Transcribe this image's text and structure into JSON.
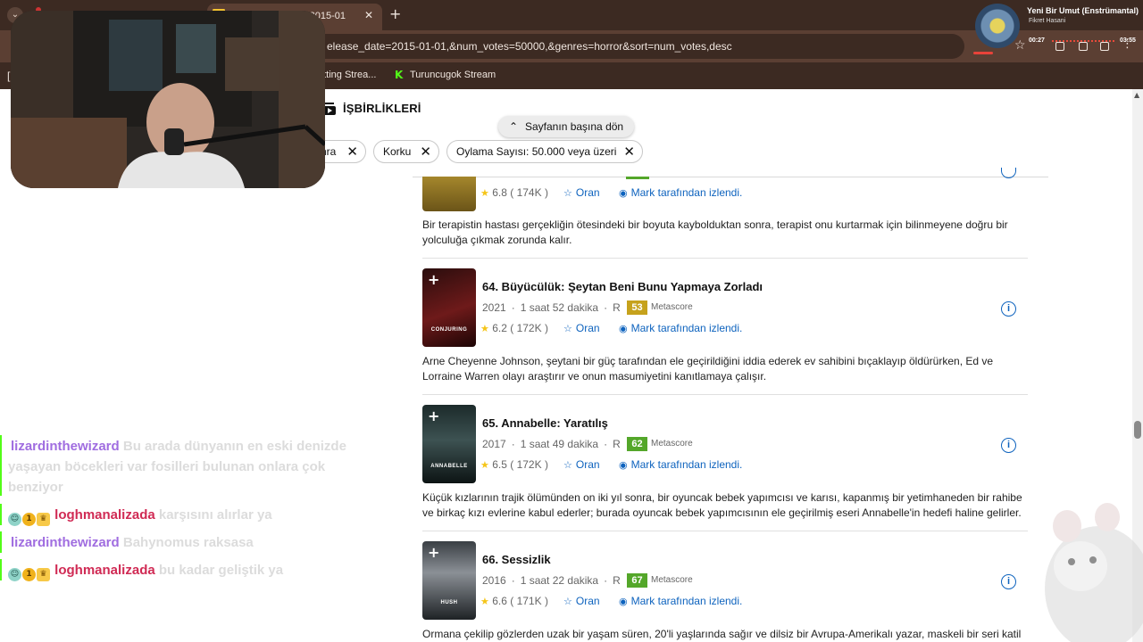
{
  "browser": {
    "tab_title": "az 2015-01",
    "url": "elease_date=2015-01-01,&num_votes=50000,&genres=horror&sort=num_votes,desc",
    "bookmarks": [
      "atting Strea...",
      "Turuncugok Stream"
    ]
  },
  "page": {
    "collab_label": "İŞBİRLİKLERİ",
    "back_to_top": "Sayfanın başına dön",
    "filter_chips": [
      {
        "label": "hra"
      },
      {
        "label": "Korku"
      },
      {
        "label": "Oylama Sayısı: 50.000 veya üzeri"
      }
    ],
    "partial_item": {
      "rating": "6.8",
      "votes": "( 174K )",
      "rate_label": "Oran",
      "seen_label": "Mark tarafından izlendi.",
      "description": "Bir terapistin hastası gerçekliğin ötesindeki bir boyuta kaybolduktan sonra, terapist onu kurtarmak için bilinmeyene doğru bir yolculuğa çıkmak zorunda kalır."
    },
    "items": [
      {
        "title": "64. Büyücülük: Şeytan Beni Bunu Yapmaya Zorladı",
        "year": "2021",
        "duration": "1 saat 52 dakika",
        "rating_cert": "R",
        "metascore": "53",
        "metascore_color": "#c6a21c",
        "metascore_label": "Metascore",
        "rating": "6.2",
        "votes": "( 172K )",
        "rate_label": "Oran",
        "seen_label": "Mark tarafından izlendi.",
        "poster_text": "CONJURING",
        "description": "Arne Cheyenne Johnson, şeytani bir güç tarafından ele geçirildiğini iddia ederek ev sahibini bıçaklayıp öldürürken, Ed ve Lorraine Warren olayı araştırır ve onun masumiyetini kanıtlamaya çalışır."
      },
      {
        "title": "65. Annabelle: Yaratılış",
        "year": "2017",
        "duration": "1 saat 49 dakika",
        "rating_cert": "R",
        "metascore": "62",
        "metascore_color": "#54a72a",
        "metascore_label": "Metascore",
        "rating": "6.5",
        "votes": "( 172K )",
        "rate_label": "Oran",
        "seen_label": "Mark tarafından izlendi.",
        "poster_text": "ANNABELLE",
        "description": "Küçük kızlarının trajik ölümünden on iki yıl sonra, bir oyuncak bebek yapımcısı ve karısı, kapanmış bir yetimhaneden bir rahibe ve birkaç kızı evlerine kabul ederler; burada oyuncak bebek yapımcısının ele geçirilmiş eseri Annabelle'in hedefi haline gelirler."
      },
      {
        "title": "66. Sessizlik",
        "year": "2016",
        "duration": "1 saat 22 dakika",
        "rating_cert": "R",
        "metascore": "67",
        "metascore_color": "#54a72a",
        "metascore_label": "Metascore",
        "rating": "6.6",
        "votes": "( 171K )",
        "rate_label": "Oran",
        "seen_label": "Mark tarafından izlendi.",
        "poster_text": "HUSH",
        "description": "Ormana çekilip gözlerden uzak bir yaşam süren, 20'li yaşlarında sağır ve dilsiz bir Avrupa-Amerikalı yazar, maskeli bir seri katil"
      }
    ]
  },
  "music": {
    "song": "Yeni Bir Umut (Enstrümantal)",
    "artist": "Fikret Hasani",
    "elapsed": "00:27",
    "total": "03:55"
  },
  "chat": [
    {
      "user": "lizardinthewizard",
      "msg_lines": [
        "Bu arada dünyanın en eski denizde",
        "yaşayan böcekleri var fosilleri bulunan onlara çok",
        "benziyor"
      ]
    },
    {
      "user": "loghmanalizada",
      "msg_lines": [
        "karşısını alırlar ya"
      ]
    },
    {
      "user": "lizardinthewizard",
      "msg_lines": [
        "Bahynomus raksasa"
      ]
    },
    {
      "user": "loghmanalizada",
      "msg_lines": [
        "bu kadar geliştik ya"
      ]
    }
  ],
  "colors": {
    "link": "#0e63be",
    "star": "#f5c518",
    "chat_purple": "#a06de0",
    "chat_red": "#d02a54"
  }
}
